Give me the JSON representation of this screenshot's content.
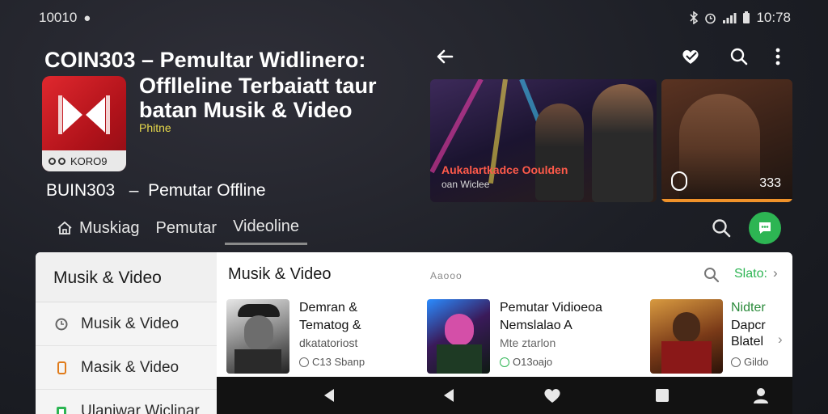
{
  "status_bar": {
    "left_text": "10010",
    "time": "10:78"
  },
  "app": {
    "title_line1": "COIN303 – Pemultar Widlinero:",
    "title_line2": "Offlleline Terbaiatt taur",
    "title_line3": "batan Musik & Video",
    "tagline": "Phitne",
    "icon_badge": "KORO9",
    "subtitle_code": "BUIN303",
    "subtitle_sep": "–",
    "subtitle_text": "Pemutar Offline"
  },
  "hero": {
    "card1_caption": "Aukalartkadce Ooulden",
    "card1_subcaption": "oan Wiclee",
    "card2_count": "333"
  },
  "tabs": [
    {
      "label": "Muskiag"
    },
    {
      "label": "Pemutar"
    },
    {
      "label": "Videoline"
    }
  ],
  "sidebar": {
    "header": "Musik & Video",
    "items": [
      {
        "label": "Musik & Video",
        "icon_color": "#666666"
      },
      {
        "label": "Masik & Video",
        "icon_color": "#e07b1a"
      },
      {
        "label": "Ulaniwar Wiclinar",
        "icon_color": "#2db553"
      }
    ]
  },
  "content": {
    "header": "Musik & Video",
    "dots_text": "Aaooo",
    "see_all": "Slato:",
    "cards": [
      {
        "title_line1": "Demran &",
        "title_line2": "Tematog &",
        "line3": "dkatatoriost",
        "meta": "C13 Sbanp"
      },
      {
        "title_line1": "Pemutar Vidioeoa",
        "title_line2": "Nemslalao A",
        "line3": "Mte ztarlon",
        "meta": "O13oajo"
      },
      {
        "title_line1": "Nidter",
        "title_line2": "Dapcr",
        "line3": "Blatel",
        "meta": "Gildo"
      }
    ]
  },
  "colors": {
    "accent_green": "#2db553",
    "app_red": "#d41f27",
    "hero_caption": "#ff5a4a"
  },
  "icons": {
    "status": [
      "bluetooth-icon",
      "alarm-icon",
      "signal-icon",
      "battery-icon"
    ],
    "toolbar": [
      "back-arrow-icon",
      "heart-check-icon",
      "search-icon",
      "more-vert-icon"
    ],
    "nav": [
      "back-triangle-icon",
      "back-triangle-icon",
      "heart-icon",
      "square-icon",
      "person-icon"
    ]
  }
}
